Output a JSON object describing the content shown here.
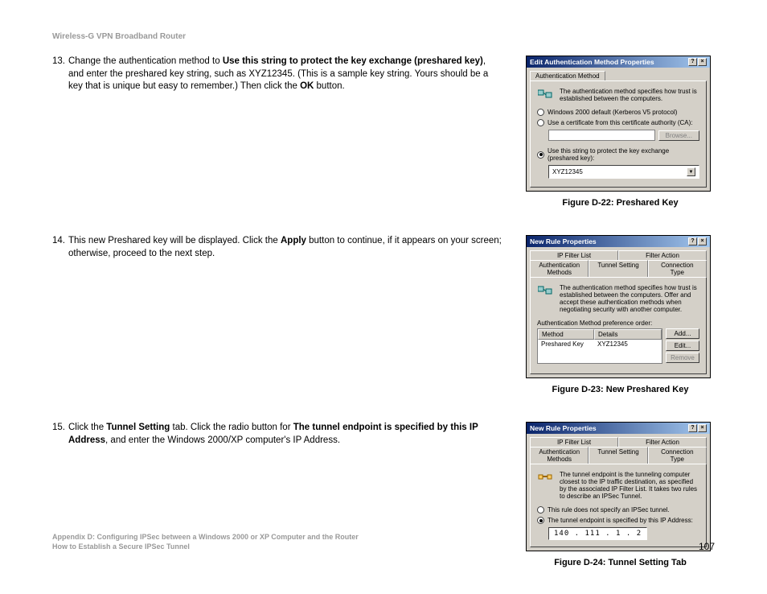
{
  "header": "Wireless-G VPN Broadband Router",
  "steps": {
    "s13": {
      "num": "13.",
      "t1": "Change the authentication method to ",
      "b1": "Use this string to protect the key exchange (preshared key)",
      "t2": ", and enter the preshared key string, such as XYZ12345. (This is a sample key string. Yours should be a key that is unique but easy to remember.) Then click the ",
      "b2": "OK",
      "t3": " button."
    },
    "s14": {
      "num": "14.",
      "t1": "This new Preshared key will be displayed. Click the ",
      "b1": "Apply",
      "t2": " button to continue, if it appears on your screen; otherwise, proceed to the next step."
    },
    "s15": {
      "num": "15.",
      "t1": "Click the ",
      "b1": "Tunnel Setting",
      "t2": " tab. Click the radio button for ",
      "b2": "The tunnel endpoint is specified by this IP Address",
      "t3": ", and enter the Windows 2000/XP computer's IP Address."
    }
  },
  "fig22": {
    "title": "Edit Authentication Method Properties",
    "tab": "Authentication Method",
    "desc": "The authentication method specifies how trust is established between the computers.",
    "opt1": "Windows 2000 default (Kerberos V5 protocol)",
    "opt2": "Use a certificate from this certificate authority (CA):",
    "browse": "Browse...",
    "opt3": "Use this string to protect the key exchange (preshared key):",
    "value": "XYZ12345",
    "caption": "Figure D-22: Preshared Key"
  },
  "fig23": {
    "title": "New Rule Properties",
    "tab_ipfilter": "IP Filter List",
    "tab_filteraction": "Filter Action",
    "tab_auth": "Authentication Methods",
    "tab_tunnel": "Tunnel Setting",
    "tab_conn": "Connection Type",
    "desc": "The authentication method specifies how trust is established between the computers. Offer and accept these authentication methods when negotiating security with another computer.",
    "pref_label": "Authentication Method preference order:",
    "col_method": "Method",
    "col_details": "Details",
    "row_method": "Preshared Key",
    "row_details": "XYZ12345",
    "btn_add": "Add...",
    "btn_edit": "Edit...",
    "btn_remove": "Remove",
    "caption": "Figure D-23: New Preshared Key"
  },
  "fig24": {
    "title": "New Rule Properties",
    "tab_ipfilter": "IP Filter List",
    "tab_filteraction": "Filter Action",
    "tab_auth": "Authentication Methods",
    "tab_tunnel": "Tunnel Setting",
    "tab_conn": "Connection Type",
    "desc": "The tunnel endpoint is the tunneling computer closest to the IP traffic destination, as specified by the associated IP Filter List. It takes two rules to describe an IPSec Tunnel.",
    "opt1": "This rule does not specify an IPSec tunnel.",
    "opt2": "The tunnel endpoint is specified by this IP Address:",
    "ip": "140 . 111 .  1  .  2",
    "caption": "Figure D-24: Tunnel Setting Tab"
  },
  "footer": {
    "line1": "Appendix D: Configuring IPSec between a Windows 2000 or XP Computer and the Router",
    "line2": "How to Establish a Secure IPSec Tunnel",
    "page": "107"
  },
  "icons": {
    "help": "?",
    "close": "×",
    "dropdown": "▼"
  }
}
